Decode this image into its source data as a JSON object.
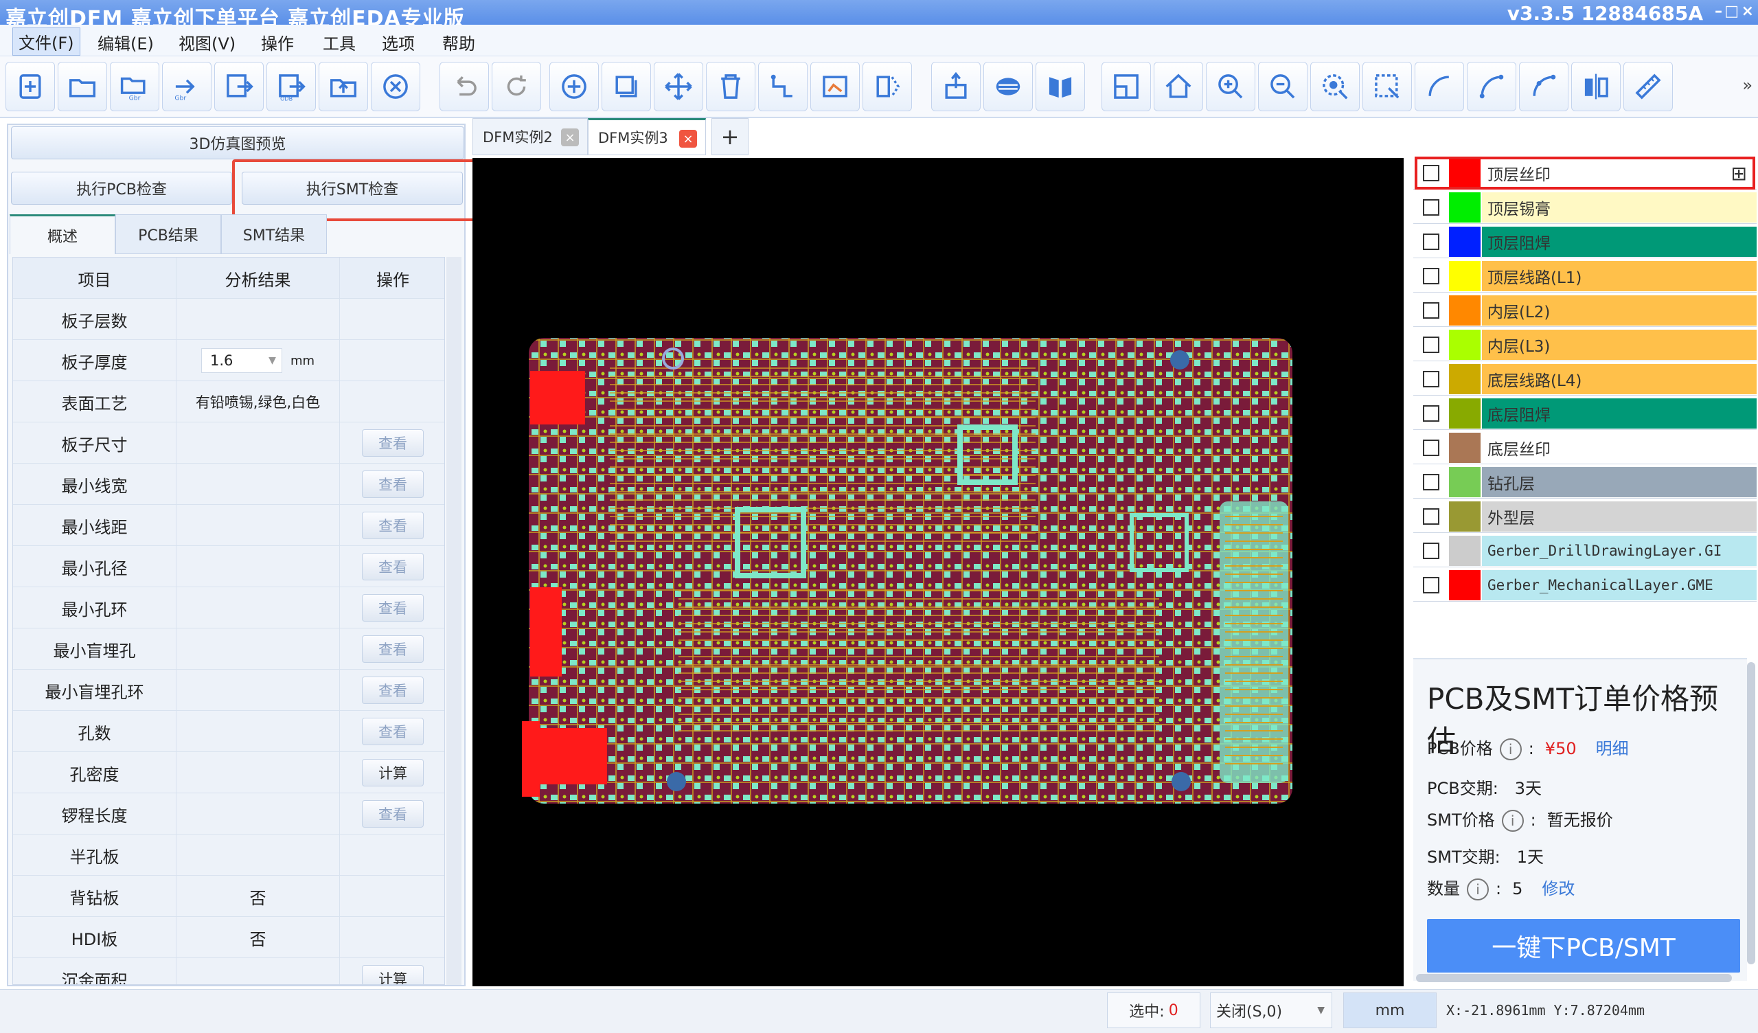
{
  "title": {
    "text": "嘉立创DFM  嘉立创下单平台  嘉立创EDA专业版",
    "version": "v3.3.5 12884685A",
    "controls": [
      "–",
      "□",
      "×"
    ]
  },
  "menu": [
    "文件(F)",
    "编辑(E)",
    "视图(V)",
    "操作",
    "工具",
    "选项",
    "帮助"
  ],
  "toolbar": {
    "icons": [
      "new-file-icon",
      "open-folder-icon",
      "open-gerber-icon",
      "edit-gerber-icon",
      "export-gerber-icon",
      "export-odb-icon",
      "upload-icon",
      "close-circle-icon",
      "undo-icon",
      "refresh-icon",
      "add-circle-icon",
      "copy-icon",
      "move-icon",
      "delete-icon",
      "route-icon",
      "board-outline-icon",
      "mirror-icon",
      "pin-icon",
      "layers-icon",
      "book-icon",
      "layout-icon",
      "home-icon",
      "zoom-in-icon",
      "zoom-out-icon",
      "zoom-area-icon",
      "select-box-icon",
      "arc-icon",
      "arc-point-icon",
      "arc-three-icon",
      "flip-icon",
      "ruler-icon"
    ],
    "labels": {
      "gbr": "Gbr",
      "odb": "ODB"
    },
    "more": "»"
  },
  "left": {
    "preview_button": "3D仿真图预览",
    "pcb_check_button": "执行PCB检查",
    "smt_check_button": "执行SMT检查",
    "tabs": [
      "概述",
      "PCB结果",
      "SMT结果"
    ],
    "headers": [
      "项目",
      "分析结果",
      "操作"
    ],
    "thickness_unit": "mm",
    "rows": [
      {
        "item": "板子层数",
        "result": "",
        "action": ""
      },
      {
        "item": "板子厚度",
        "result": "1.6",
        "action": ""
      },
      {
        "item": "表面工艺",
        "result": "有铅喷锡,绿色,白色",
        "action": ""
      },
      {
        "item": "板子尺寸",
        "result": "",
        "action": "查看"
      },
      {
        "item": "最小线宽",
        "result": "",
        "action": "查看"
      },
      {
        "item": "最小线距",
        "result": "",
        "action": "查看"
      },
      {
        "item": "最小孔径",
        "result": "",
        "action": "查看"
      },
      {
        "item": "最小孔环",
        "result": "",
        "action": "查看"
      },
      {
        "item": "最小盲埋孔",
        "result": "",
        "action": "查看"
      },
      {
        "item": "最小盲埋孔环",
        "result": "",
        "action": "查看"
      },
      {
        "item": "孔数",
        "result": "",
        "action": "查看"
      },
      {
        "item": "孔密度",
        "result": "",
        "action": "计算"
      },
      {
        "item": "锣程长度",
        "result": "",
        "action": "查看"
      },
      {
        "item": "半孔板",
        "result": "",
        "action": ""
      },
      {
        "item": "背钻板",
        "result": "否",
        "action": ""
      },
      {
        "item": "HDI板",
        "result": "否",
        "action": ""
      },
      {
        "item": "沉金面积",
        "result": "",
        "action": "计算"
      }
    ]
  },
  "doc_tabs": [
    {
      "label": "DFM实例2",
      "close": "×"
    },
    {
      "label": "DFM实例3",
      "close": "×"
    }
  ],
  "add_tab": "+",
  "layers": [
    {
      "name": "顶层丝印",
      "swatch": "#ff0000",
      "bg": "#ffffff"
    },
    {
      "name": "顶层锡膏",
      "swatch": "#00ee00",
      "bg": "#fff9c4"
    },
    {
      "name": "顶层阻焊",
      "swatch": "#0020ff",
      "bg": "#009977"
    },
    {
      "name": "顶层线路(L1)",
      "swatch": "#ffff00",
      "bg": "#ffc04a"
    },
    {
      "name": "内层(L2)",
      "swatch": "#ff8800",
      "bg": "#ffc04a"
    },
    {
      "name": "内层(L3)",
      "swatch": "#aaff00",
      "bg": "#ffc04a"
    },
    {
      "name": "底层线路(L4)",
      "swatch": "#ccaa00",
      "bg": "#ffc04a"
    },
    {
      "name": "底层阻焊",
      "swatch": "#88aa00",
      "bg": "#009977"
    },
    {
      "name": "底层丝印",
      "swatch": "#aa7755",
      "bg": "#ffffff"
    },
    {
      "name": "钻孔层",
      "swatch": "#77cc55",
      "bg": "#98a8b8"
    },
    {
      "name": "外型层",
      "swatch": "#999933",
      "bg": "#d4d4d4"
    },
    {
      "name": "Gerber_DrillDrawingLayer.GI",
      "swatch": "#cccccc",
      "bg": "#b8e8f0"
    },
    {
      "name": "Gerber_MechanicalLayer.GME",
      "swatch": "#ff0000",
      "bg": "#b8e8f0"
    }
  ],
  "layer_grid_icon": "grid-icon",
  "price": {
    "title": "PCB及SMT订单价格预估",
    "pcb_price_label": "PCB价格",
    "pcb_price": "¥50",
    "detail_link": "明细",
    "pcb_lead_label": "PCB交期:",
    "pcb_lead": "3天",
    "smt_price_label": "SMT价格",
    "smt_price": "暂无报价",
    "smt_lead_label": "SMT交期:",
    "smt_lead": "1天",
    "qty_label": "数量",
    "qty": "5",
    "modify_link": "修改",
    "colon": ":",
    "info": "i",
    "order_button": "一键下PCB/SMT"
  },
  "status": {
    "selected_label": "选中:",
    "selected_count": "0",
    "snap": "关闭(S,0)",
    "unit": "mm",
    "coords": "X:-21.8961mm Y:7.87204mm"
  },
  "colors": {
    "accent": "#4b8ef7",
    "highlight": "#e84a3a",
    "board": "#7a1b3a",
    "canvas": "#000000"
  }
}
